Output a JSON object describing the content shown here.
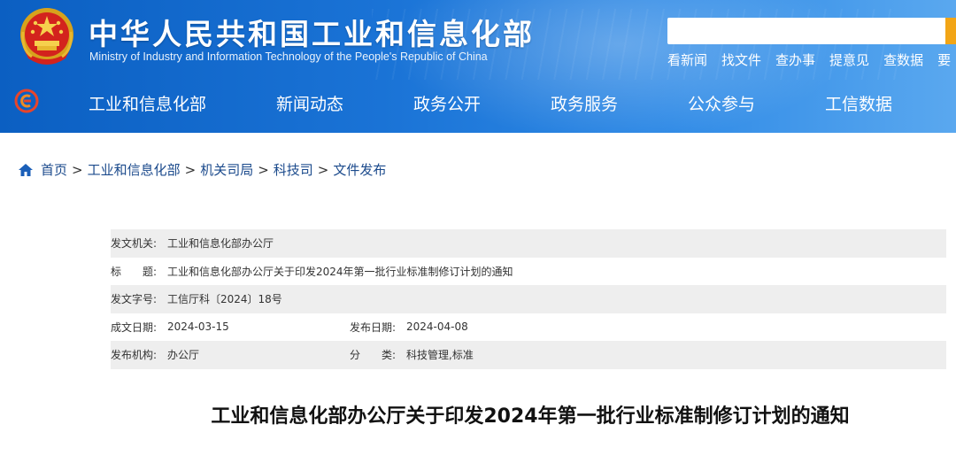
{
  "header": {
    "site_title": "中华人民共和国工业和信息化部",
    "site_subtitle": "Ministry of Industry and Information Technology of the People's Republic of China",
    "search": {
      "value": "",
      "placeholder": ""
    },
    "quick_links": [
      "看新闻",
      "找文件",
      "查办事",
      "提意见",
      "查数据",
      "要"
    ],
    "colors": {
      "header_start": "#0b5fc2",
      "header_end": "#5aa8ef",
      "search_button": "#f2a516"
    }
  },
  "nav": {
    "items": [
      "工业和信息化部",
      "新闻动态",
      "政务公开",
      "政务服务",
      "公众参与",
      "工信数据"
    ]
  },
  "breadcrumb": {
    "items": [
      "首页",
      "工业和信息化部",
      "机关司局",
      "科技司",
      "文件发布"
    ],
    "separator": ">"
  },
  "meta": {
    "issuer_label": "发文机关:",
    "issuer_value": "工业和信息化部办公厅",
    "title_label": "标　　题:",
    "title_value": "工业和信息化部办公厅关于印发2024年第一批行业标准制修订计划的通知",
    "doc_no_label": "发文字号:",
    "doc_no_value": "工信厅科〔2024〕18号",
    "written_label": "成文日期:",
    "written_value": "2024-03-15",
    "published_label": "发布日期:",
    "published_value": "2024-04-08",
    "org_label": "发布机构:",
    "org_value": "办公厅",
    "category_label": "分　　类:",
    "category_value": "科技管理,标准"
  },
  "article": {
    "title": "工业和信息化部办公厅关于印发2024年第一批行业标准制修订计划的通知"
  }
}
